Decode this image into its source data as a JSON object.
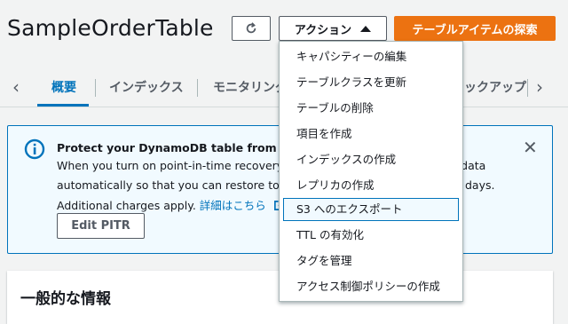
{
  "header": {
    "title": "SampleOrderTable",
    "actions_label": "アクション",
    "explore_label": "テーブルアイテムの探索"
  },
  "tabs": [
    {
      "label": "概要",
      "active": true
    },
    {
      "label": "インデックス"
    },
    {
      "label": "モニタリング"
    },
    {
      "label": "ックアップ"
    }
  ],
  "info": {
    "title": "Protect your DynamoDB table from accide",
    "line1_a": "When you turn on point-in-time recovery (",
    "line1_b": "le data",
    "line2_a": "automatically so that you can restore to an",
    "line2_b": "days.",
    "line3": "Additional charges apply.",
    "link": "詳細はこちら",
    "edit_button": "Edit PITR"
  },
  "panel": {
    "title": "一般的な情報"
  },
  "menu": {
    "items": [
      "キャパシティーの編集",
      "テーブルクラスを更新",
      "テーブルの削除",
      "項目を作成",
      "インデックスの作成",
      "レプリカの作成",
      "S3 へのエクスポート",
      "TTL の有効化",
      "タグを管理",
      "アクセス制御ポリシーの作成"
    ],
    "highlighted_index": 6
  },
  "colors": {
    "accent": "#0073bb",
    "primary_button": "#ec7211",
    "info_bg": "#f1faff"
  }
}
